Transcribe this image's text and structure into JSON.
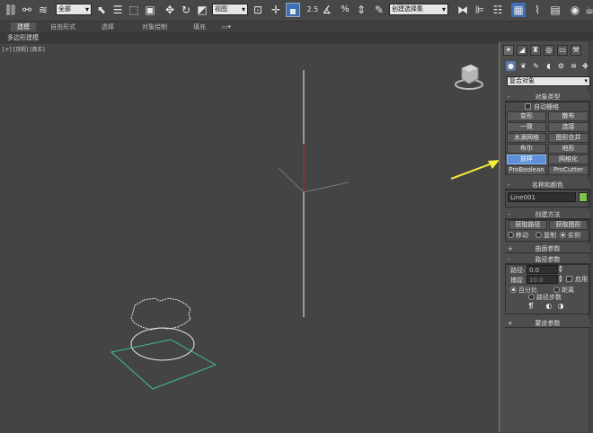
{
  "toolbar": {
    "selection_filter": "全部",
    "ref_coord": "视图",
    "named_selection": "创建选择集",
    "snap_label": "2.5",
    "angle_snap_label": "3",
    "percent_snap_label": "%"
  },
  "ribbon": {
    "tabs": [
      "建模",
      "自由形式",
      "选择",
      "对象绘制",
      "填充"
    ],
    "subtitle": "多边形建模"
  },
  "viewport": {
    "label": "[+] [顶视] [真实]"
  },
  "panel": {
    "category": "复合对象",
    "object_type": {
      "header": "对象类型",
      "autogrid": "自动栅格",
      "buttons": [
        [
          "变形",
          "散布"
        ],
        [
          "一致",
          "连接"
        ],
        [
          "水滴网格",
          "图形合并"
        ],
        [
          "布尔",
          "地形"
        ],
        [
          "放样",
          "网格化"
        ],
        [
          "ProBoolean",
          "ProCutter"
        ]
      ]
    },
    "name_color": {
      "header": "名称和颜色",
      "name": "Line001",
      "color": "#7ec44a"
    },
    "creation_method": {
      "header": "创建方法",
      "get_path": "获取路径",
      "get_shape": "获取图形",
      "move": "移动",
      "copy": "复制",
      "instance": "实例"
    },
    "surface_params": {
      "header": "曲面参数"
    },
    "path_params": {
      "header": "路径参数",
      "path_label": "路径:",
      "path_value": "0.0",
      "snap_label": "捕捉:",
      "snap_value": "10.0",
      "enable": "启用",
      "percent": "百分比",
      "distance": "距离",
      "path_steps": "路径步数"
    },
    "skin_params": {
      "header": "蒙皮参数"
    }
  }
}
